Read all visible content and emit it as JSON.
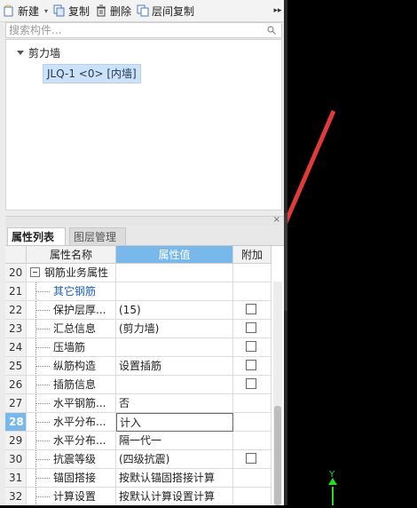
{
  "toolbar": {
    "new_label": "新建",
    "copy_label": "复制",
    "delete_label": "删除",
    "floor_copy_label": "层间复制",
    "more_label": "▸▸"
  },
  "search": {
    "placeholder": "搜索构件..."
  },
  "tree": {
    "root_label": "剪力墙",
    "child_label": "JLQ-1 <0> [内墙]"
  },
  "tabs": [
    {
      "label": "属性列表"
    },
    {
      "label": "图层管理"
    }
  ],
  "grid": {
    "headers": {
      "name": "属性名称",
      "value": "属性值",
      "extra": "附加"
    },
    "rows": [
      {
        "num": "20",
        "name": "钢筋业务属性",
        "value": "",
        "checkbox": false,
        "group": true
      },
      {
        "num": "21",
        "name": "其它钢筋",
        "value": "",
        "checkbox": false,
        "link": true
      },
      {
        "num": "22",
        "name": "保护层厚...",
        "value": "(15)",
        "checkbox": true
      },
      {
        "num": "23",
        "name": "汇总信息",
        "value": "(剪力墙)",
        "checkbox": true
      },
      {
        "num": "24",
        "name": "压墙筋",
        "value": "",
        "checkbox": true
      },
      {
        "num": "25",
        "name": "纵筋构造",
        "value": "设置插筋",
        "checkbox": true
      },
      {
        "num": "26",
        "name": "插筋信息",
        "value": "",
        "checkbox": true
      },
      {
        "num": "27",
        "name": "水平钢筋...",
        "value": "否",
        "checkbox": false
      },
      {
        "num": "28",
        "name": "水平分布...",
        "value": "计入",
        "checkbox": false,
        "current": true
      },
      {
        "num": "29",
        "name": "水平分布...",
        "value": "隔一代一",
        "checkbox": false
      },
      {
        "num": "30",
        "name": "抗震等级",
        "value": "(四级抗震)",
        "checkbox": true
      },
      {
        "num": "31",
        "name": "锚固搭接",
        "value": "按默认锚固搭接计算",
        "checkbox": false
      },
      {
        "num": "32",
        "name": "计算设置",
        "value": "按默认计算设置计算",
        "checkbox": false
      }
    ]
  },
  "colors": {
    "header_blue": "#79b8ea",
    "arrow_red": "#e03a3a",
    "axis_green": "#22dd22"
  }
}
